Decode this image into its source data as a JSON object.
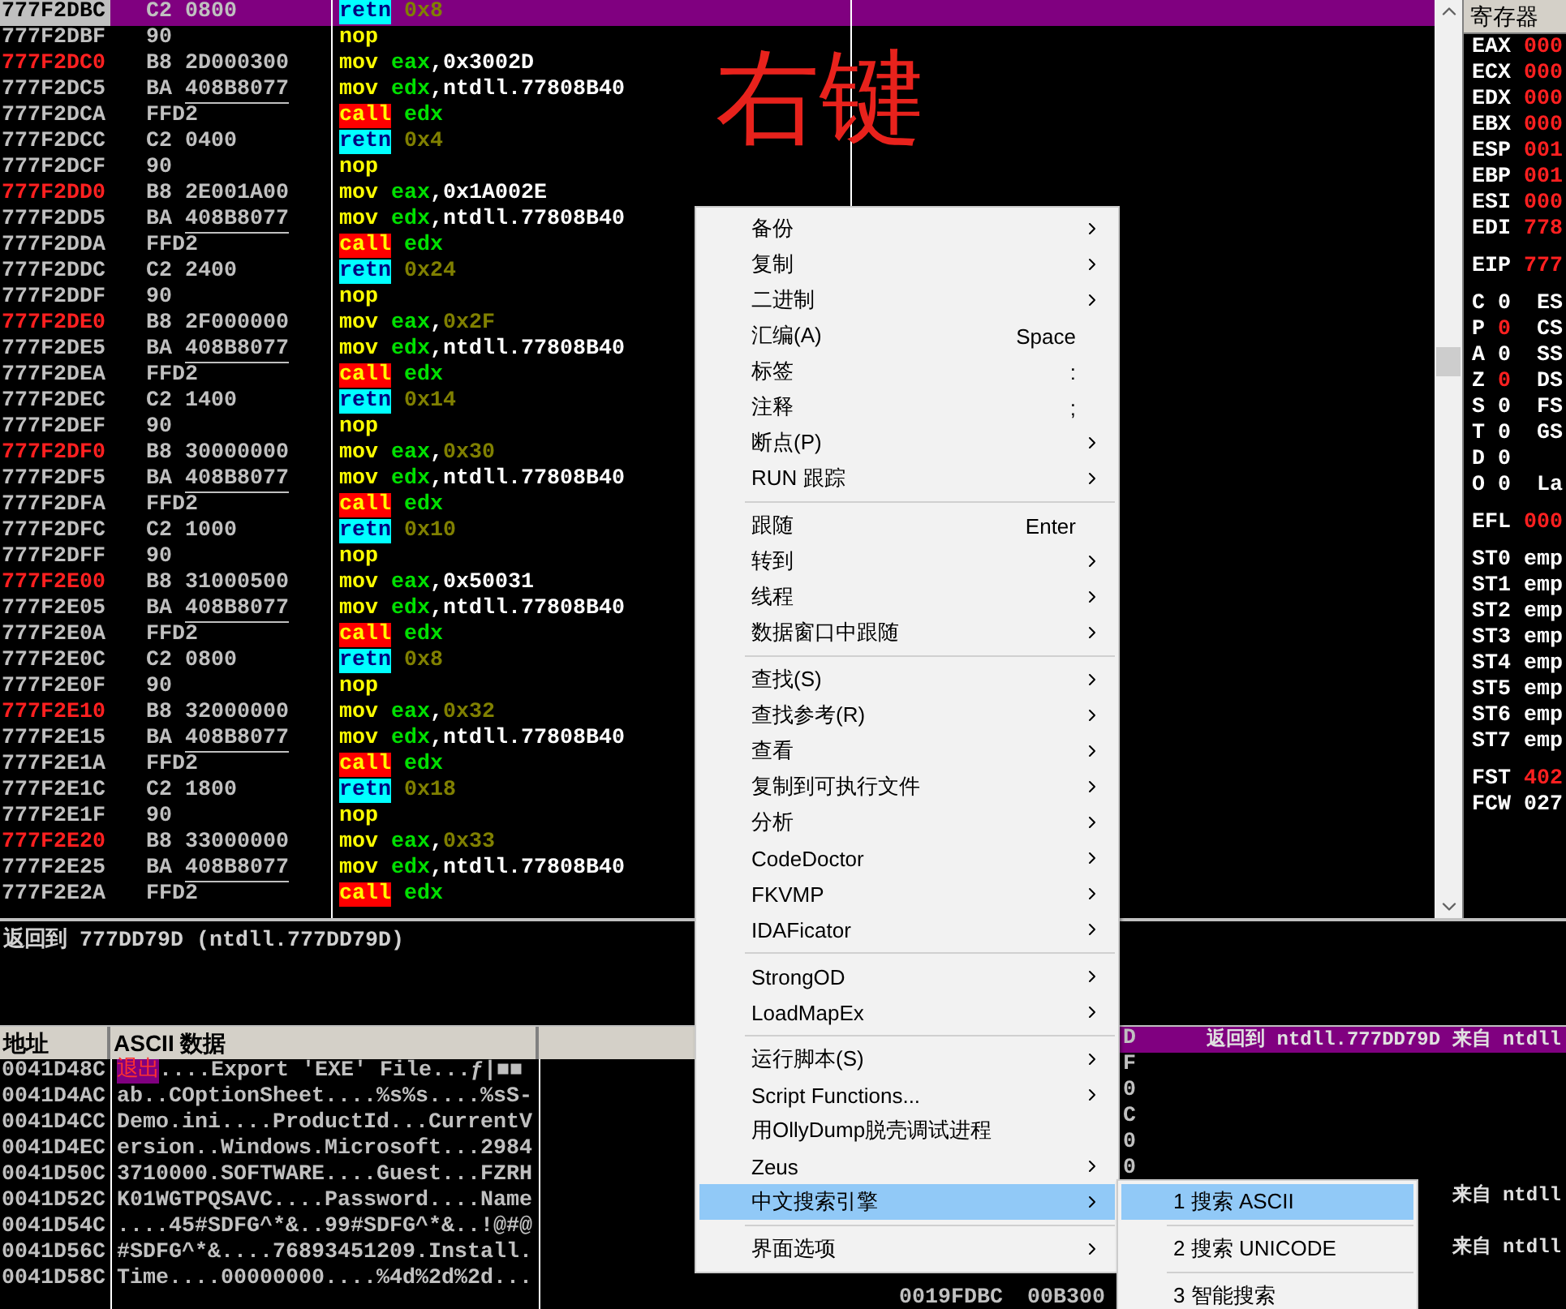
{
  "annotation": {
    "text": "右键"
  },
  "disassembly": {
    "rows": [
      {
        "address": "777F2DBC",
        "target": false,
        "opcode": "C2",
        "operand": "0800",
        "fixup": false,
        "mnemonic": {
          "text": "retn",
          "kind": "ret"
        },
        "args": [
          {
            "text": "0x8",
            "kind": "const"
          }
        ],
        "selected": true
      },
      {
        "address": "777F2DBF",
        "target": false,
        "opcode": "90",
        "mnemonic": {
          "text": "nop",
          "kind": "plain"
        },
        "args": [],
        "selected": false
      },
      {
        "address": "777F2DC0",
        "target": true,
        "opcode": "B8",
        "operand": "2D000300",
        "fixup": false,
        "mnemonic": {
          "text": "mov",
          "kind": "plain"
        },
        "args": [
          {
            "text": "eax",
            "kind": "reg"
          },
          {
            "text": ",0x3002D",
            "kind": "plain"
          }
        ],
        "selected": false
      },
      {
        "address": "777F2DC5",
        "target": false,
        "opcode": "BA",
        "operand": "408B8077",
        "fixup": true,
        "mnemonic": {
          "text": "mov",
          "kind": "plain"
        },
        "args": [
          {
            "text": "edx",
            "kind": "reg"
          },
          {
            "text": ",ntdll.77808B40",
            "kind": "plain"
          }
        ],
        "selected": false
      },
      {
        "address": "777F2DCA",
        "target": false,
        "opcode": "FFD2",
        "mnemonic": {
          "text": "call",
          "kind": "call"
        },
        "args": [
          {
            "text": "edx",
            "kind": "reg"
          }
        ],
        "selected": false
      },
      {
        "address": "777F2DCC",
        "target": false,
        "opcode": "C2",
        "operand": "0400",
        "fixup": false,
        "mnemonic": {
          "text": "retn",
          "kind": "ret"
        },
        "args": [
          {
            "text": "0x4",
            "kind": "const"
          }
        ],
        "selected": false
      },
      {
        "address": "777F2DCF",
        "target": false,
        "opcode": "90",
        "mnemonic": {
          "text": "nop",
          "kind": "plain"
        },
        "args": [],
        "selected": false
      },
      {
        "address": "777F2DD0",
        "target": true,
        "opcode": "B8",
        "operand": "2E001A00",
        "fixup": false,
        "mnemonic": {
          "text": "mov",
          "kind": "plain"
        },
        "args": [
          {
            "text": "eax",
            "kind": "reg"
          },
          {
            "text": ",0x1A002E",
            "kind": "plain"
          }
        ],
        "selected": false
      },
      {
        "address": "777F2DD5",
        "target": false,
        "opcode": "BA",
        "operand": "408B8077",
        "fixup": true,
        "mnemonic": {
          "text": "mov",
          "kind": "plain"
        },
        "args": [
          {
            "text": "edx",
            "kind": "reg"
          },
          {
            "text": ",ntdll.77808B40",
            "kind": "plain"
          }
        ],
        "selected": false
      },
      {
        "address": "777F2DDA",
        "target": false,
        "opcode": "FFD2",
        "mnemonic": {
          "text": "call",
          "kind": "call"
        },
        "args": [
          {
            "text": "edx",
            "kind": "reg"
          }
        ],
        "selected": false
      },
      {
        "address": "777F2DDC",
        "target": false,
        "opcode": "C2",
        "operand": "2400",
        "fixup": false,
        "mnemonic": {
          "text": "retn",
          "kind": "ret"
        },
        "args": [
          {
            "text": "0x24",
            "kind": "const"
          }
        ],
        "selected": false
      },
      {
        "address": "777F2DDF",
        "target": false,
        "opcode": "90",
        "mnemonic": {
          "text": "nop",
          "kind": "plain"
        },
        "args": [],
        "selected": false
      },
      {
        "address": "777F2DE0",
        "target": true,
        "opcode": "B8",
        "operand": "2F000000",
        "fixup": false,
        "mnemonic": {
          "text": "mov",
          "kind": "plain"
        },
        "args": [
          {
            "text": "eax",
            "kind": "reg"
          },
          {
            "text": ",",
            "kind": "plain"
          },
          {
            "text": "0x2F",
            "kind": "const"
          }
        ],
        "selected": false
      },
      {
        "address": "777F2DE5",
        "target": false,
        "opcode": "BA",
        "operand": "408B8077",
        "fixup": true,
        "mnemonic": {
          "text": "mov",
          "kind": "plain"
        },
        "args": [
          {
            "text": "edx",
            "kind": "reg"
          },
          {
            "text": ",ntdll.77808B40",
            "kind": "plain"
          }
        ],
        "selected": false
      },
      {
        "address": "777F2DEA",
        "target": false,
        "opcode": "FFD2",
        "mnemonic": {
          "text": "call",
          "kind": "call"
        },
        "args": [
          {
            "text": "edx",
            "kind": "reg"
          }
        ],
        "selected": false
      },
      {
        "address": "777F2DEC",
        "target": false,
        "opcode": "C2",
        "operand": "1400",
        "fixup": false,
        "mnemonic": {
          "text": "retn",
          "kind": "ret"
        },
        "args": [
          {
            "text": "0x14",
            "kind": "const"
          }
        ],
        "selected": false
      },
      {
        "address": "777F2DEF",
        "target": false,
        "opcode": "90",
        "mnemonic": {
          "text": "nop",
          "kind": "plain"
        },
        "args": [],
        "selected": false
      },
      {
        "address": "777F2DF0",
        "target": true,
        "opcode": "B8",
        "operand": "30000000",
        "fixup": false,
        "mnemonic": {
          "text": "mov",
          "kind": "plain"
        },
        "args": [
          {
            "text": "eax",
            "kind": "reg"
          },
          {
            "text": ",",
            "kind": "plain"
          },
          {
            "text": "0x30",
            "kind": "const"
          }
        ],
        "selected": false
      },
      {
        "address": "777F2DF5",
        "target": false,
        "opcode": "BA",
        "operand": "408B8077",
        "fixup": true,
        "mnemonic": {
          "text": "mov",
          "kind": "plain"
        },
        "args": [
          {
            "text": "edx",
            "kind": "reg"
          },
          {
            "text": ",ntdll.77808B40",
            "kind": "plain"
          }
        ],
        "selected": false
      },
      {
        "address": "777F2DFA",
        "target": false,
        "opcode": "FFD2",
        "mnemonic": {
          "text": "call",
          "kind": "call"
        },
        "args": [
          {
            "text": "edx",
            "kind": "reg"
          }
        ],
        "selected": false
      },
      {
        "address": "777F2DFC",
        "target": false,
        "opcode": "C2",
        "operand": "1000",
        "fixup": false,
        "mnemonic": {
          "text": "retn",
          "kind": "ret"
        },
        "args": [
          {
            "text": "0x10",
            "kind": "const"
          }
        ],
        "selected": false
      },
      {
        "address": "777F2DFF",
        "target": false,
        "opcode": "90",
        "mnemonic": {
          "text": "nop",
          "kind": "plain"
        },
        "args": [],
        "selected": false
      },
      {
        "address": "777F2E00",
        "target": true,
        "opcode": "B8",
        "operand": "31000500",
        "fixup": false,
        "mnemonic": {
          "text": "mov",
          "kind": "plain"
        },
        "args": [
          {
            "text": "eax",
            "kind": "reg"
          },
          {
            "text": ",0x50031",
            "kind": "plain"
          }
        ],
        "selected": false
      },
      {
        "address": "777F2E05",
        "target": false,
        "opcode": "BA",
        "operand": "408B8077",
        "fixup": true,
        "mnemonic": {
          "text": "mov",
          "kind": "plain"
        },
        "args": [
          {
            "text": "edx",
            "kind": "reg"
          },
          {
            "text": ",ntdll.77808B40",
            "kind": "plain"
          }
        ],
        "selected": false
      },
      {
        "address": "777F2E0A",
        "target": false,
        "opcode": "FFD2",
        "mnemonic": {
          "text": "call",
          "kind": "call"
        },
        "args": [
          {
            "text": "edx",
            "kind": "reg"
          }
        ],
        "selected": false
      },
      {
        "address": "777F2E0C",
        "target": false,
        "opcode": "C2",
        "operand": "0800",
        "fixup": false,
        "mnemonic": {
          "text": "retn",
          "kind": "ret"
        },
        "args": [
          {
            "text": "0x8",
            "kind": "const"
          }
        ],
        "selected": false
      },
      {
        "address": "777F2E0F",
        "target": false,
        "opcode": "90",
        "mnemonic": {
          "text": "nop",
          "kind": "plain"
        },
        "args": [],
        "selected": false
      },
      {
        "address": "777F2E10",
        "target": true,
        "opcode": "B8",
        "operand": "32000000",
        "fixup": false,
        "mnemonic": {
          "text": "mov",
          "kind": "plain"
        },
        "args": [
          {
            "text": "eax",
            "kind": "reg"
          },
          {
            "text": ",",
            "kind": "plain"
          },
          {
            "text": "0x32",
            "kind": "const"
          }
        ],
        "selected": false
      },
      {
        "address": "777F2E15",
        "target": false,
        "opcode": "BA",
        "operand": "408B8077",
        "fixup": true,
        "mnemonic": {
          "text": "mov",
          "kind": "plain"
        },
        "args": [
          {
            "text": "edx",
            "kind": "reg"
          },
          {
            "text": ",ntdll.77808B40",
            "kind": "plain"
          }
        ],
        "selected": false
      },
      {
        "address": "777F2E1A",
        "target": false,
        "opcode": "FFD2",
        "mnemonic": {
          "text": "call",
          "kind": "call"
        },
        "args": [
          {
            "text": "edx",
            "kind": "reg"
          }
        ],
        "selected": false
      },
      {
        "address": "777F2E1C",
        "target": false,
        "opcode": "C2",
        "operand": "1800",
        "fixup": false,
        "mnemonic": {
          "text": "retn",
          "kind": "ret"
        },
        "args": [
          {
            "text": "0x18",
            "kind": "const"
          }
        ],
        "selected": false
      },
      {
        "address": "777F2E1F",
        "target": false,
        "opcode": "90",
        "mnemonic": {
          "text": "nop",
          "kind": "plain"
        },
        "args": [],
        "selected": false
      },
      {
        "address": "777F2E20",
        "target": true,
        "opcode": "B8",
        "operand": "33000000",
        "fixup": false,
        "mnemonic": {
          "text": "mov",
          "kind": "plain"
        },
        "args": [
          {
            "text": "eax",
            "kind": "reg"
          },
          {
            "text": ",",
            "kind": "plain"
          },
          {
            "text": "0x33",
            "kind": "const"
          }
        ],
        "selected": false
      },
      {
        "address": "777F2E25",
        "target": false,
        "opcode": "BA",
        "operand": "408B8077",
        "fixup": true,
        "mnemonic": {
          "text": "mov",
          "kind": "plain"
        },
        "args": [
          {
            "text": "edx",
            "kind": "reg"
          },
          {
            "text": ",ntdll.77808B40",
            "kind": "plain"
          }
        ],
        "selected": false
      },
      {
        "address": "777F2E2A",
        "target": false,
        "opcode": "FFD2",
        "mnemonic": {
          "text": "call",
          "kind": "call"
        },
        "args": [
          {
            "text": "edx",
            "kind": "reg"
          }
        ],
        "selected": false
      }
    ]
  },
  "registers": {
    "title": "寄存器",
    "groups": [
      [
        {
          "kind": "reg",
          "name": "EAX",
          "value": "000",
          "changed": true
        },
        {
          "kind": "reg",
          "name": "ECX",
          "value": "000",
          "changed": true
        },
        {
          "kind": "reg",
          "name": "EDX",
          "value": "000",
          "changed": true
        },
        {
          "kind": "reg",
          "name": "EBX",
          "value": "000",
          "changed": true
        },
        {
          "kind": "reg",
          "name": "ESP",
          "value": "001",
          "changed": true
        },
        {
          "kind": "reg",
          "name": "EBP",
          "value": "001",
          "changed": true
        },
        {
          "kind": "reg",
          "name": "ESI",
          "value": "000",
          "changed": true
        },
        {
          "kind": "reg",
          "name": "EDI",
          "value": "778",
          "changed": true
        }
      ],
      [
        {
          "kind": "reg",
          "name": "EIP",
          "value": "777",
          "changed": true
        }
      ],
      [
        {
          "kind": "flag",
          "name": "C",
          "value": "0",
          "changed": false,
          "segment": "ES"
        },
        {
          "kind": "flag",
          "name": "P",
          "value": "0",
          "changed": true,
          "segment": "CS"
        },
        {
          "kind": "flag",
          "name": "A",
          "value": "0",
          "changed": false,
          "segment": "SS"
        },
        {
          "kind": "flag",
          "name": "Z",
          "value": "0",
          "changed": true,
          "segment": "DS"
        },
        {
          "kind": "flag",
          "name": "S",
          "value": "0",
          "changed": false,
          "segment": "FS"
        },
        {
          "kind": "flag",
          "name": "T",
          "value": "0",
          "changed": false,
          "segment": "GS"
        },
        {
          "kind": "flag",
          "name": "D",
          "value": "0",
          "changed": false
        },
        {
          "kind": "flag",
          "name": "O",
          "value": "0",
          "changed": false,
          "segment": "La"
        }
      ],
      [
        {
          "kind": "reg",
          "name": "EFL",
          "value": "000",
          "changed": true
        }
      ],
      [
        {
          "kind": "reg",
          "name": "ST0",
          "value": "emp",
          "changed": false
        },
        {
          "kind": "reg",
          "name": "ST1",
          "value": "emp",
          "changed": false
        },
        {
          "kind": "reg",
          "name": "ST2",
          "value": "emp",
          "changed": false
        },
        {
          "kind": "reg",
          "name": "ST3",
          "value": "emp",
          "changed": false
        },
        {
          "kind": "reg",
          "name": "ST4",
          "value": "emp",
          "changed": false
        },
        {
          "kind": "reg",
          "name": "ST5",
          "value": "emp",
          "changed": false
        },
        {
          "kind": "reg",
          "name": "ST6",
          "value": "emp",
          "changed": false
        },
        {
          "kind": "reg",
          "name": "ST7",
          "value": "emp",
          "changed": false
        }
      ],
      [
        {
          "kind": "reg",
          "name": "FST",
          "value": "402",
          "changed": true
        },
        {
          "kind": "reg",
          "name": "FCW",
          "value": "027",
          "changed": false
        }
      ]
    ]
  },
  "info_pane": {
    "text": "返回到 777DD79D (ntdll.777DD79D)"
  },
  "dump": {
    "columns": [
      "地址",
      "ASCII 数据"
    ],
    "rows": [
      {
        "address": "0041D48C",
        "marked": "退出",
        "text": "....Export 'EXE' File...ƒ|■■"
      },
      {
        "address": "0041D4AC",
        "text": "ab..COptionSheet....%s%s....%sS-"
      },
      {
        "address": "0041D4CC",
        "text": "Demo.ini....ProductId...CurrentV"
      },
      {
        "address": "0041D4EC",
        "text": "ersion..Windows.Microsoft...2984"
      },
      {
        "address": "0041D50C",
        "text": "3710000.SOFTWARE....Guest...FZRH"
      },
      {
        "address": "0041D52C",
        "text": "K01WGTPQSAVC....Password....Name"
      },
      {
        "address": "0041D54C",
        "text": "....45#SDFG^*&..99#SDFG^*&..!@#@"
      },
      {
        "address": "0041D56C",
        "text": "#SDFG^*&....76893451209.Install."
      },
      {
        "address": "0041D58C",
        "text": "Time....00000000....%4d%2d%2d..."
      }
    ]
  },
  "stack": {
    "rows": [
      {
        "kind": "tail",
        "value": "D",
        "comment": "返回到 ntdll.777DD79D 来自 ntdll",
        "selected": true
      },
      {
        "kind": "tail",
        "value": "F",
        "selected": false
      },
      {
        "kind": "tail",
        "value": "0",
        "selected": false
      },
      {
        "kind": "tail",
        "value": "C",
        "selected": false
      },
      {
        "kind": "tail",
        "value": "0",
        "selected": false
      },
      {
        "kind": "tail",
        "value": "0",
        "selected": false
      },
      {
        "kind": "tail",
        "comment": "来自 ntdll",
        "selected": false
      },
      {
        "kind": "blank"
      },
      {
        "kind": "tail",
        "comment": "来自 ntdll",
        "selected": false
      },
      {
        "kind": "blank"
      },
      {
        "kind": "head",
        "address": "0019FDBC",
        "value": "00B300",
        "selected": false
      }
    ]
  },
  "context_menu": {
    "items": [
      {
        "kind": "item",
        "label": "备份",
        "submenu": true,
        "selected": false
      },
      {
        "kind": "item",
        "label": "复制",
        "submenu": true,
        "selected": false
      },
      {
        "kind": "item",
        "label": "二进制",
        "submenu": true,
        "selected": false
      },
      {
        "kind": "item",
        "label": "汇编(A)",
        "shortcut": "Space",
        "submenu": false,
        "selected": false
      },
      {
        "kind": "item",
        "label": "标签",
        "shortcut": ":",
        "submenu": false,
        "selected": false
      },
      {
        "kind": "item",
        "label": "注释",
        "shortcut": ";",
        "submenu": false,
        "selected": false
      },
      {
        "kind": "item",
        "label": "断点(P)",
        "submenu": true,
        "selected": false
      },
      {
        "kind": "item",
        "label": "RUN 跟踪",
        "submenu": true,
        "selected": false
      },
      {
        "kind": "separator"
      },
      {
        "kind": "item",
        "label": "跟随",
        "shortcut": "Enter",
        "submenu": false,
        "selected": false
      },
      {
        "kind": "item",
        "label": "转到",
        "submenu": true,
        "selected": false
      },
      {
        "kind": "item",
        "label": "线程",
        "submenu": true,
        "selected": false
      },
      {
        "kind": "item",
        "label": "数据窗口中跟随",
        "submenu": true,
        "selected": false
      },
      {
        "kind": "separator"
      },
      {
        "kind": "item",
        "label": "查找(S)",
        "submenu": true,
        "selected": false
      },
      {
        "kind": "item",
        "label": "查找参考(R)",
        "submenu": true,
        "selected": false
      },
      {
        "kind": "item",
        "label": "查看",
        "submenu": true,
        "selected": false
      },
      {
        "kind": "item",
        "label": "复制到可执行文件",
        "submenu": true,
        "selected": false
      },
      {
        "kind": "item",
        "label": "分析",
        "submenu": true,
        "selected": false
      },
      {
        "kind": "item",
        "label": "CodeDoctor",
        "submenu": true,
        "selected": false
      },
      {
        "kind": "item",
        "label": "FKVMP",
        "submenu": true,
        "selected": false
      },
      {
        "kind": "item",
        "label": "IDAFicator",
        "submenu": true,
        "selected": false
      },
      {
        "kind": "separator"
      },
      {
        "kind": "item",
        "label": "StrongOD",
        "submenu": true,
        "selected": false
      },
      {
        "kind": "item",
        "label": "LoadMapEx",
        "submenu": true,
        "selected": false
      },
      {
        "kind": "separator"
      },
      {
        "kind": "item",
        "label": "运行脚本(S)",
        "submenu": true,
        "selected": false
      },
      {
        "kind": "item",
        "label": "Script Functions...",
        "submenu": true,
        "selected": false
      },
      {
        "kind": "item",
        "label": "用OllyDump脱壳调试进程",
        "submenu": false,
        "selected": false
      },
      {
        "kind": "item",
        "label": "Zeus",
        "submenu": true,
        "selected": false
      },
      {
        "kind": "item",
        "label": "中文搜索引擎",
        "submenu": true,
        "selected": true
      },
      {
        "kind": "separator"
      },
      {
        "kind": "item",
        "label": "界面选项",
        "submenu": true,
        "selected": false
      }
    ]
  },
  "submenu": {
    "items": [
      {
        "kind": "item",
        "label": "1 搜索 ASCII",
        "selected": true
      },
      {
        "kind": "separator"
      },
      {
        "kind": "item",
        "label": "2 搜索 UNICODE",
        "selected": false
      },
      {
        "kind": "separator"
      },
      {
        "kind": "item",
        "label": "3 智能搜索",
        "selected": false
      }
    ]
  }
}
